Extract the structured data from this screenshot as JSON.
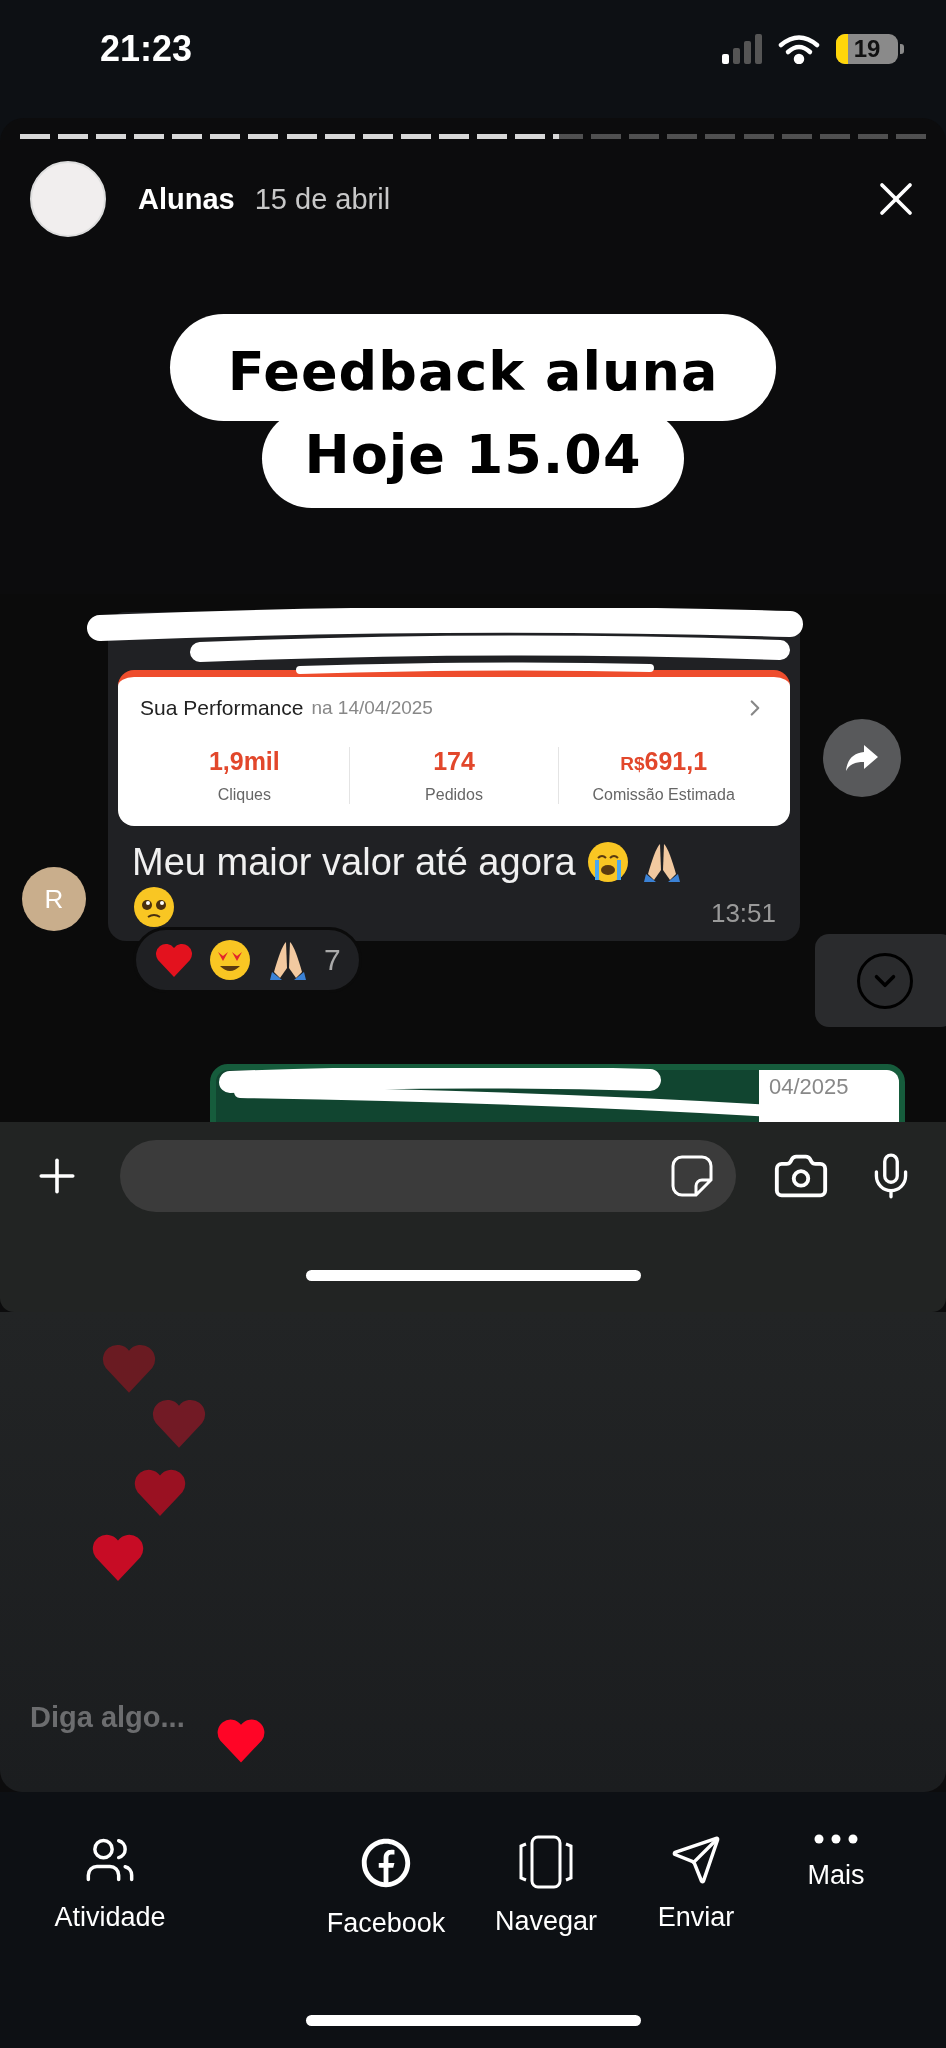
{
  "status_bar": {
    "time": "21:23",
    "battery": {
      "text": "19",
      "level": 0.2
    }
  },
  "story": {
    "progress": {
      "level": 0.595
    },
    "account": "Alunas",
    "date": "15 de abril",
    "sticker_lines": [
      "Feedback aluna",
      "Hoje 15.04"
    ]
  },
  "chat": {
    "avatar_initial": "R",
    "card": {
      "title": "Sua Performance",
      "subtitle": "na 14/04/2025",
      "stats": [
        {
          "value": "1,9mil",
          "label": "Cliques"
        },
        {
          "value": "174",
          "label": "Pedidos"
        },
        {
          "prefix": "R$",
          "value": "691,1",
          "label": "Comissão Estimada"
        }
      ]
    },
    "message": "Meu maior valor até agora",
    "time": "13:51",
    "reactions": {
      "count": "7"
    },
    "next_bubble_date": "04/2025"
  },
  "hearts": [
    {
      "color": "#6a1b22"
    },
    {
      "color": "#721a25"
    },
    {
      "color": "#9a1122"
    },
    {
      "color": "#c70c25"
    },
    {
      "color": "#ff0526"
    }
  ],
  "reply_field": {
    "placeholder": "Diga algo..."
  },
  "actions": [
    {
      "kind": "activity",
      "label": "Atividade"
    },
    {
      "kind": "facebook",
      "label": "Facebook"
    },
    {
      "kind": "browse",
      "label": "Navegar"
    },
    {
      "kind": "send",
      "label": "Enviar"
    },
    {
      "kind": "more",
      "label": "Mais"
    }
  ]
}
